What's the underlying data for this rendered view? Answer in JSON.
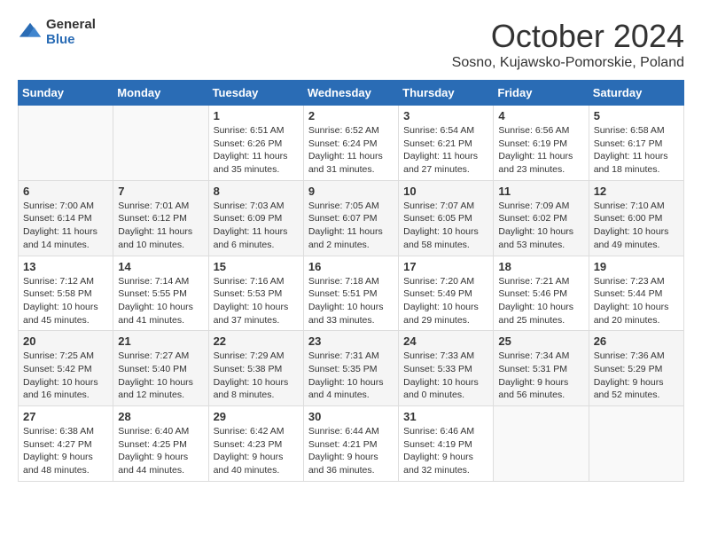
{
  "header": {
    "logo_general": "General",
    "logo_blue": "Blue",
    "month_title": "October 2024",
    "location": "Sosno, Kujawsko-Pomorskie, Poland"
  },
  "days_of_week": [
    "Sunday",
    "Monday",
    "Tuesday",
    "Wednesday",
    "Thursday",
    "Friday",
    "Saturday"
  ],
  "weeks": [
    [
      {
        "day": "",
        "info": ""
      },
      {
        "day": "",
        "info": ""
      },
      {
        "day": "1",
        "info": "Sunrise: 6:51 AM\nSunset: 6:26 PM\nDaylight: 11 hours and 35 minutes."
      },
      {
        "day": "2",
        "info": "Sunrise: 6:52 AM\nSunset: 6:24 PM\nDaylight: 11 hours and 31 minutes."
      },
      {
        "day": "3",
        "info": "Sunrise: 6:54 AM\nSunset: 6:21 PM\nDaylight: 11 hours and 27 minutes."
      },
      {
        "day": "4",
        "info": "Sunrise: 6:56 AM\nSunset: 6:19 PM\nDaylight: 11 hours and 23 minutes."
      },
      {
        "day": "5",
        "info": "Sunrise: 6:58 AM\nSunset: 6:17 PM\nDaylight: 11 hours and 18 minutes."
      }
    ],
    [
      {
        "day": "6",
        "info": "Sunrise: 7:00 AM\nSunset: 6:14 PM\nDaylight: 11 hours and 14 minutes."
      },
      {
        "day": "7",
        "info": "Sunrise: 7:01 AM\nSunset: 6:12 PM\nDaylight: 11 hours and 10 minutes."
      },
      {
        "day": "8",
        "info": "Sunrise: 7:03 AM\nSunset: 6:09 PM\nDaylight: 11 hours and 6 minutes."
      },
      {
        "day": "9",
        "info": "Sunrise: 7:05 AM\nSunset: 6:07 PM\nDaylight: 11 hours and 2 minutes."
      },
      {
        "day": "10",
        "info": "Sunrise: 7:07 AM\nSunset: 6:05 PM\nDaylight: 10 hours and 58 minutes."
      },
      {
        "day": "11",
        "info": "Sunrise: 7:09 AM\nSunset: 6:02 PM\nDaylight: 10 hours and 53 minutes."
      },
      {
        "day": "12",
        "info": "Sunrise: 7:10 AM\nSunset: 6:00 PM\nDaylight: 10 hours and 49 minutes."
      }
    ],
    [
      {
        "day": "13",
        "info": "Sunrise: 7:12 AM\nSunset: 5:58 PM\nDaylight: 10 hours and 45 minutes."
      },
      {
        "day": "14",
        "info": "Sunrise: 7:14 AM\nSunset: 5:55 PM\nDaylight: 10 hours and 41 minutes."
      },
      {
        "day": "15",
        "info": "Sunrise: 7:16 AM\nSunset: 5:53 PM\nDaylight: 10 hours and 37 minutes."
      },
      {
        "day": "16",
        "info": "Sunrise: 7:18 AM\nSunset: 5:51 PM\nDaylight: 10 hours and 33 minutes."
      },
      {
        "day": "17",
        "info": "Sunrise: 7:20 AM\nSunset: 5:49 PM\nDaylight: 10 hours and 29 minutes."
      },
      {
        "day": "18",
        "info": "Sunrise: 7:21 AM\nSunset: 5:46 PM\nDaylight: 10 hours and 25 minutes."
      },
      {
        "day": "19",
        "info": "Sunrise: 7:23 AM\nSunset: 5:44 PM\nDaylight: 10 hours and 20 minutes."
      }
    ],
    [
      {
        "day": "20",
        "info": "Sunrise: 7:25 AM\nSunset: 5:42 PM\nDaylight: 10 hours and 16 minutes."
      },
      {
        "day": "21",
        "info": "Sunrise: 7:27 AM\nSunset: 5:40 PM\nDaylight: 10 hours and 12 minutes."
      },
      {
        "day": "22",
        "info": "Sunrise: 7:29 AM\nSunset: 5:38 PM\nDaylight: 10 hours and 8 minutes."
      },
      {
        "day": "23",
        "info": "Sunrise: 7:31 AM\nSunset: 5:35 PM\nDaylight: 10 hours and 4 minutes."
      },
      {
        "day": "24",
        "info": "Sunrise: 7:33 AM\nSunset: 5:33 PM\nDaylight: 10 hours and 0 minutes."
      },
      {
        "day": "25",
        "info": "Sunrise: 7:34 AM\nSunset: 5:31 PM\nDaylight: 9 hours and 56 minutes."
      },
      {
        "day": "26",
        "info": "Sunrise: 7:36 AM\nSunset: 5:29 PM\nDaylight: 9 hours and 52 minutes."
      }
    ],
    [
      {
        "day": "27",
        "info": "Sunrise: 6:38 AM\nSunset: 4:27 PM\nDaylight: 9 hours and 48 minutes."
      },
      {
        "day": "28",
        "info": "Sunrise: 6:40 AM\nSunset: 4:25 PM\nDaylight: 9 hours and 44 minutes."
      },
      {
        "day": "29",
        "info": "Sunrise: 6:42 AM\nSunset: 4:23 PM\nDaylight: 9 hours and 40 minutes."
      },
      {
        "day": "30",
        "info": "Sunrise: 6:44 AM\nSunset: 4:21 PM\nDaylight: 9 hours and 36 minutes."
      },
      {
        "day": "31",
        "info": "Sunrise: 6:46 AM\nSunset: 4:19 PM\nDaylight: 9 hours and 32 minutes."
      },
      {
        "day": "",
        "info": ""
      },
      {
        "day": "",
        "info": ""
      }
    ]
  ]
}
